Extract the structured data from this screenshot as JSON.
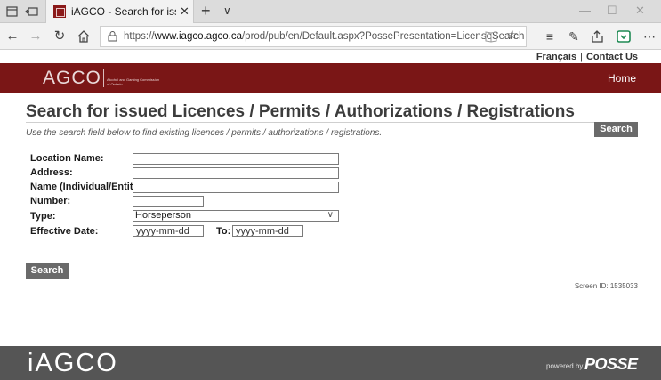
{
  "browser": {
    "tab_title": "iAGCO - Search for issu",
    "tab_close": "✕",
    "new_tab": "+",
    "tab_menu": "∨",
    "url_prefix": "https://",
    "url_domain": "www.iagco.agco.ca",
    "url_path": "/prod/pub/en/Default.aspx?PossePresentation=LicenseSearch"
  },
  "header": {
    "utility_links": [
      "Français",
      "Contact Us"
    ],
    "logo_text": "AGCO",
    "logo_subtext": "Alcohol and Gaming Commission of Ontario",
    "home_link": "Home"
  },
  "main": {
    "title": "Search for issued Licences / Permits / Authorizations / Registrations",
    "instructions": "Use the search field below to find existing licences / permits / authorizations / registrations.",
    "search_top_label": "Search",
    "form": {
      "location_name_label": "Location Name:",
      "address_label": "Address:",
      "name_label": "Name (Individual/Entity):",
      "number_label": "Number:",
      "type_label": "Type:",
      "type_value": "Horseperson",
      "effective_date_label": "Effective Date:",
      "effective_from_value": "yyyy-mm-dd",
      "to_label": "To:",
      "effective_to_value": "yyyy-mm-dd"
    },
    "search_bottom_label": "Search",
    "screen_id": "Screen ID: 1535033"
  },
  "footer": {
    "logo_text": "iAGCO",
    "powered_by": "powered by",
    "posse_text": "POSSE"
  },
  "colors": {
    "banner": "#7a1616",
    "footer": "#555555",
    "button": "#6a6a6a"
  }
}
